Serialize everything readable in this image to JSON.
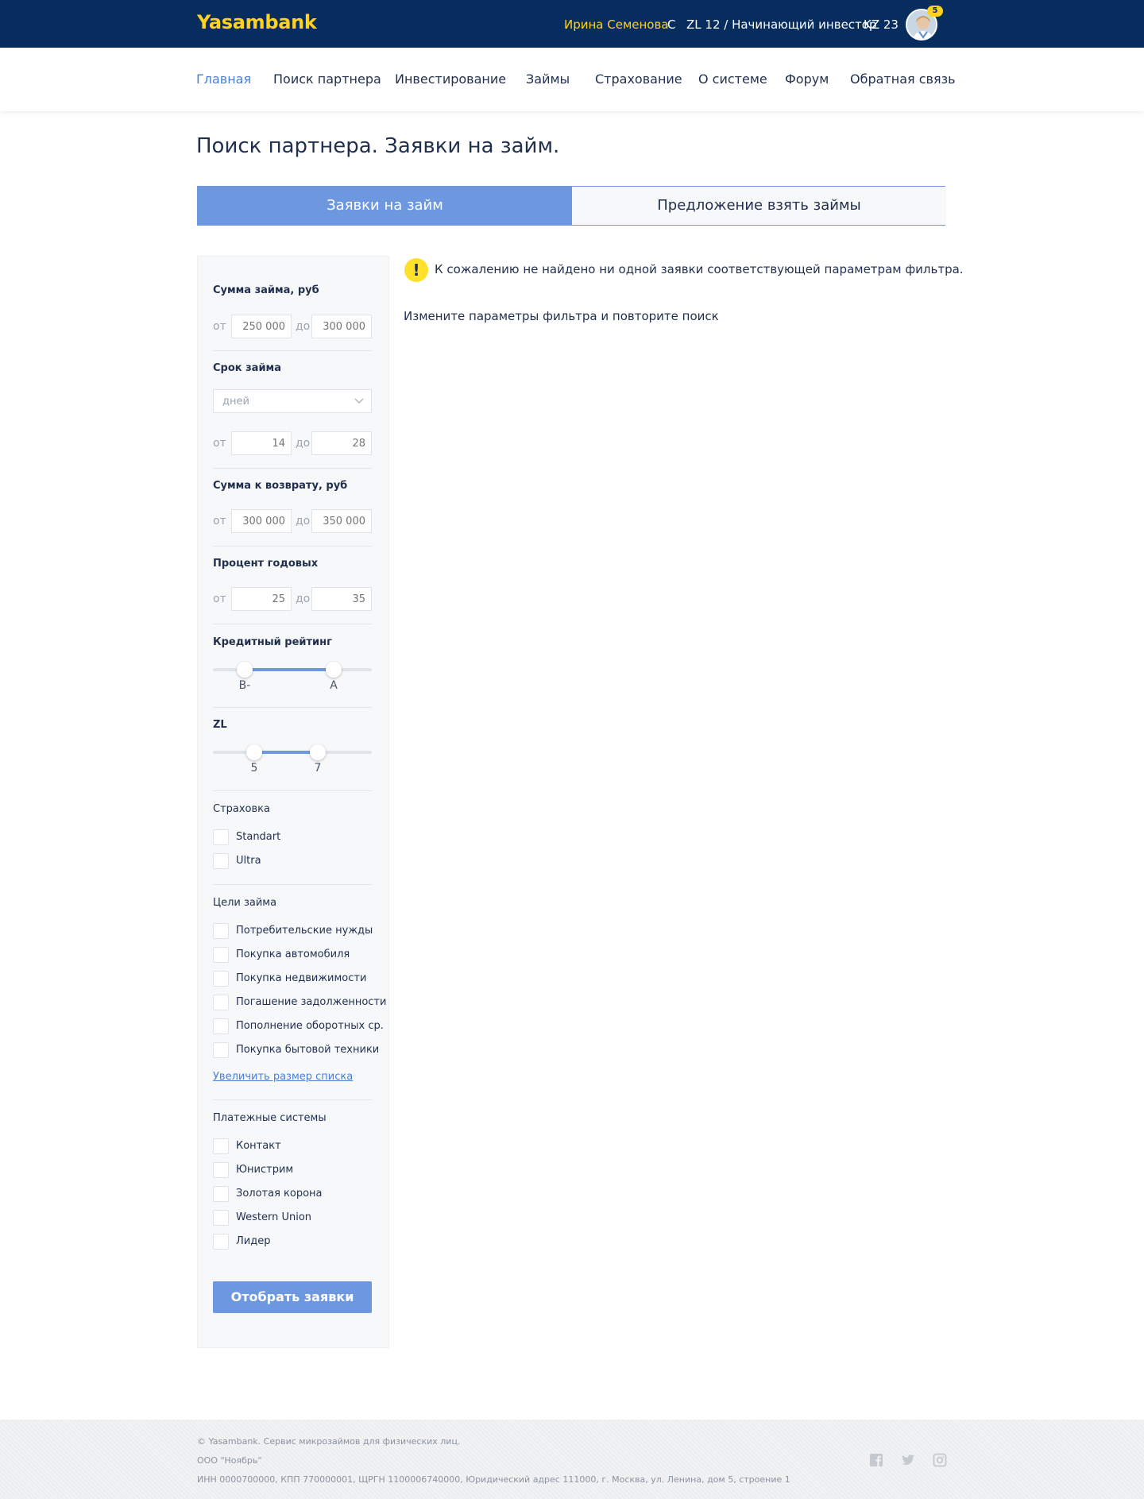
{
  "header": {
    "logo": "Yasambank",
    "user_name": "Ирина Семенова",
    "c_label": "C",
    "zl_status": "ZL 12 / Начинающий инвестор",
    "kz": "KZ 23",
    "notifications": "5"
  },
  "nav": {
    "items": [
      "Главная",
      "Поиск партнера",
      "Инвестирование",
      "Займы",
      "Страхование",
      "О системе",
      "Форум",
      "Обратная связь"
    ],
    "active": "Главная"
  },
  "page": {
    "title": "Поиск партнера. Заявки на займ."
  },
  "tabs": [
    {
      "label": "Заявки на займ",
      "active": true
    },
    {
      "label": "Предложение взять займы",
      "active": false
    }
  ],
  "filters": {
    "from_label": "от",
    "to_label": "до",
    "loan_amount": {
      "label": "Сумма займа, руб",
      "from": "250 000",
      "to": "300 000"
    },
    "loan_term": {
      "label": "Срок займа",
      "unit": "дней",
      "from": "14",
      "to": "28"
    },
    "return_amount": {
      "label": "Сумма к возврату, руб",
      "from": "300 000",
      "to": "350 000"
    },
    "annual_rate": {
      "label": "Процент годовых",
      "from": "25",
      "to": "35"
    },
    "credit_rating": {
      "label": "Кредитный рейтинг",
      "min": "B-",
      "max": "A",
      "range_fraction": [
        0.2,
        0.76
      ]
    },
    "zl": {
      "label": "ZL",
      "min": "5",
      "max": "7",
      "range_fraction": [
        0.26,
        0.66
      ]
    },
    "insurance": {
      "label": "Страховка",
      "options": [
        "Standart",
        "Ultra"
      ]
    },
    "purposes": {
      "label": "Цели займа",
      "options": [
        "Потребительские нужды",
        "Покупка автомобиля",
        "Покупка недвижимости",
        "Погашение задолженности",
        "Пополнение оборотных ср.",
        "Покупка бытовой техники"
      ],
      "more_link": "Увеличить размер списка"
    },
    "payment_systems": {
      "label": "Платежные системы",
      "options": [
        "Контакт",
        "Юнистрим",
        "Золотая корона",
        "Western Union",
        "Лидер"
      ]
    },
    "submit_label": "Отобрать заявки"
  },
  "results": {
    "warning": "К сожалению не найдено ни одной заявки соответствующей параметрам фильтра.",
    "hint": "Измените параметры фильтра и повторите поиск"
  },
  "footer": {
    "copyright": "© Yasambank. Сервис микрозаймов для физических лиц.",
    "company": "ООО \"Ноябрь\"",
    "details": "ИНН 0000700000, КПП 770000001, ЩРГН 1100006740000, Юридический адрес 111000, г. Москва, ул. Ленина, дом 5, строение 1"
  },
  "colors": {
    "header_bg": "#062d5e",
    "accent": "#6d98e0",
    "logo": "#ffd21f",
    "warning": "#ffe12b"
  },
  "icons": [
    "warning-icon",
    "chevron-down-icon",
    "facebook-icon",
    "twitter-icon",
    "instagram-icon",
    "avatar"
  ]
}
